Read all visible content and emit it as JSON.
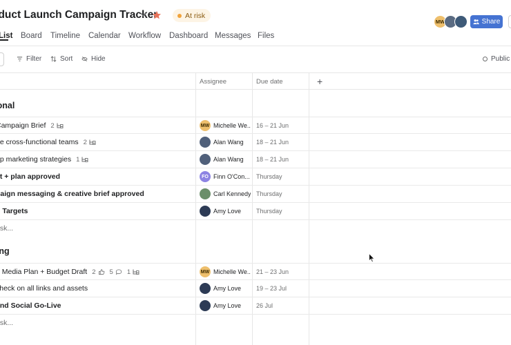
{
  "header": {
    "title": "oduct Launch Campaign Tracker",
    "status": "At risk",
    "members": [
      "MW",
      "",
      ""
    ],
    "share_label": "Share"
  },
  "tabs": [
    "List",
    "Board",
    "Timeline",
    "Calendar",
    "Workflow",
    "Dashboard",
    "Messages",
    "Files"
  ],
  "toolbar": {
    "filter": "Filter",
    "sort": "Sort",
    "hide": "Hide",
    "public": "Public li"
  },
  "columns": {
    "assignee": "Assignee",
    "due_date": "Due date",
    "add": "+"
  },
  "sections": [
    {
      "name": "tional",
      "add_task": "ask...",
      "tasks": [
        {
          "name": "Campaign Brief",
          "subtasks": "2",
          "assignee": "Michelle We...",
          "initials": "MW",
          "due": "16 – 21 Jun"
        },
        {
          "name": "ge cross-functional teams",
          "subtasks": "2",
          "assignee": "Alan Wang",
          "initials": "",
          "due": "18 – 21 Jun"
        },
        {
          "name": "op marketing strategies",
          "subtasks": "1",
          "assignee": "Alan Wang",
          "initials": "",
          "due": "18 – 21 Jun"
        },
        {
          "name": "et + plan approved",
          "assignee": "Finn O'Con...",
          "initials": "FO",
          "due": "Thursday"
        },
        {
          "name": "paign messaging & creative brief approved",
          "assignee": "Carl Kennedy",
          "initials": "",
          "due": "Thursday"
        },
        {
          "name": "d Targets",
          "assignee": "Amy Love",
          "initials": "",
          "due": "Thursday"
        }
      ]
    },
    {
      "name": "sing",
      "add_task": "ask...",
      "tasks": [
        {
          "name": "e Media Plan + Budget Draft",
          "likes": "2",
          "comments": "5",
          "subtasks": "1",
          "assignee": "Michelle We...",
          "initials": "MW",
          "due": "21 – 23 Jun"
        },
        {
          "name": "check on all links and assets",
          "assignee": "Amy Love",
          "initials": "",
          "due": "19 – 23 Jul"
        },
        {
          "name": "and Social Go-Live",
          "assignee": "Amy Love",
          "initials": "",
          "due": "26 Jul"
        }
      ]
    }
  ],
  "colors": {
    "accent": "#4573d2",
    "at_risk": "#f1a33b",
    "star": "#e8735a"
  }
}
